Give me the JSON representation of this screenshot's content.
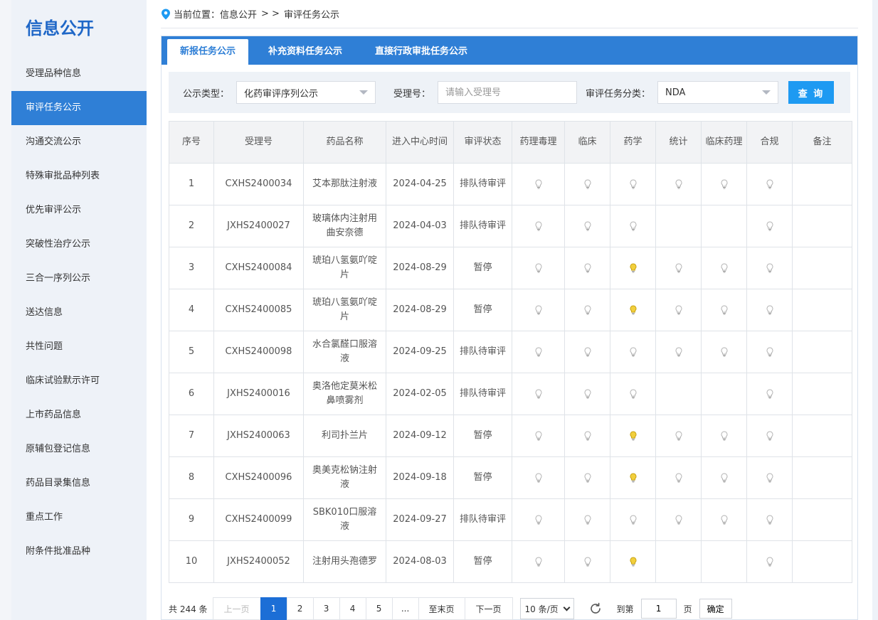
{
  "sidebar": {
    "title": "信息公开",
    "items": [
      {
        "label": "受理品种信息",
        "active": false
      },
      {
        "label": "审评任务公示",
        "active": true
      },
      {
        "label": "沟通交流公示",
        "active": false
      },
      {
        "label": "特殊审批品种列表",
        "active": false
      },
      {
        "label": "优先审评公示",
        "active": false
      },
      {
        "label": "突破性治疗公示",
        "active": false
      },
      {
        "label": "三合一序列公示",
        "active": false
      },
      {
        "label": "送达信息",
        "active": false
      },
      {
        "label": "共性问题",
        "active": false
      },
      {
        "label": "临床试验默示许可",
        "active": false
      },
      {
        "label": "上市药品信息",
        "active": false
      },
      {
        "label": "原辅包登记信息",
        "active": false
      },
      {
        "label": "药品目录集信息",
        "active": false
      },
      {
        "label": "重点工作",
        "active": false
      },
      {
        "label": "附条件批准品种",
        "active": false
      }
    ]
  },
  "breadcrumb": {
    "prefix": "当前位置：",
    "home": "信息公开",
    "separator": "> >",
    "current": "审评任务公示"
  },
  "tabs": [
    {
      "label": "新报任务公示",
      "active": true
    },
    {
      "label": "补充资料任务公示",
      "active": false
    },
    {
      "label": "直接行政审批任务公示",
      "active": false
    }
  ],
  "filters": {
    "type_label": "公示类型：",
    "type_value": "化药审评序列公示",
    "acceptance_label": "受理号：",
    "acceptance_placeholder": "请输入受理号",
    "category_label": "审评任务分类：",
    "category_value": "NDA",
    "query_button": "查 询"
  },
  "colors": {
    "accent": "#2f7fd6",
    "bulb_off": "#c8c8c8",
    "bulb_on": "#f2cf3c"
  },
  "table": {
    "columns": [
      "序号",
      "受理号",
      "药品名称",
      "进入中心时间",
      "审评状态",
      "药理毒理",
      "临床",
      "药学",
      "统计",
      "临床药理",
      "合规",
      "备注"
    ],
    "rows": [
      {
        "no": "1",
        "id": "CXHS2400034",
        "name": "艾本那肽注射液",
        "date": "2024-04-25",
        "status": "排队待审评",
        "bulbs": [
          "off",
          "off",
          "off",
          "off",
          "off",
          "off"
        ],
        "note": ""
      },
      {
        "no": "2",
        "id": "JXHS2400027",
        "name": "玻璃体内注射用曲安奈德",
        "date": "2024-04-03",
        "status": "排队待审评",
        "bulbs": [
          "off",
          "off",
          "off",
          "none",
          "none",
          "off"
        ],
        "note": ""
      },
      {
        "no": "3",
        "id": "CXHS2400084",
        "name": "琥珀八氢氨吖啶片",
        "date": "2024-08-29",
        "status": "暂停",
        "bulbs": [
          "off",
          "off",
          "on",
          "off",
          "off",
          "off"
        ],
        "note": ""
      },
      {
        "no": "4",
        "id": "CXHS2400085",
        "name": "琥珀八氢氨吖啶片",
        "date": "2024-08-29",
        "status": "暂停",
        "bulbs": [
          "off",
          "off",
          "on",
          "off",
          "off",
          "off"
        ],
        "note": ""
      },
      {
        "no": "5",
        "id": "CXHS2400098",
        "name": "水合氯醛口服溶液",
        "date": "2024-09-25",
        "status": "排队待审评",
        "bulbs": [
          "off",
          "off",
          "off",
          "off",
          "off",
          "off"
        ],
        "note": ""
      },
      {
        "no": "6",
        "id": "JXHS2400016",
        "name": "奥洛他定莫米松鼻喷雾剂",
        "date": "2024-02-05",
        "status": "排队待审评",
        "bulbs": [
          "off",
          "off",
          "off",
          "none",
          "none",
          "off"
        ],
        "note": ""
      },
      {
        "no": "7",
        "id": "JXHS2400063",
        "name": "利司扑兰片",
        "date": "2024-09-12",
        "status": "暂停",
        "bulbs": [
          "off",
          "off",
          "on",
          "off",
          "off",
          "off"
        ],
        "note": ""
      },
      {
        "no": "8",
        "id": "CXHS2400096",
        "name": "奥美克松钠注射液",
        "date": "2024-09-18",
        "status": "暂停",
        "bulbs": [
          "off",
          "off",
          "on",
          "off",
          "off",
          "off"
        ],
        "note": ""
      },
      {
        "no": "9",
        "id": "CXHS2400099",
        "name": "SBK010口服溶液",
        "date": "2024-09-27",
        "status": "排队待审评",
        "bulbs": [
          "off",
          "off",
          "off",
          "off",
          "off",
          "off"
        ],
        "note": ""
      },
      {
        "no": "10",
        "id": "JXHS2400052",
        "name": "注射用头孢德罗",
        "date": "2024-08-03",
        "status": "暂停",
        "bulbs": [
          "off",
          "off",
          "on",
          "none",
          "none",
          "off"
        ],
        "note": ""
      }
    ]
  },
  "pagination": {
    "total": "共 244 条",
    "prev": "上一页",
    "pages": [
      "1",
      "2",
      "3",
      "4",
      "5"
    ],
    "current": "1",
    "ellipsis": "...",
    "last": "至末页",
    "next": "下一页",
    "page_size": "10 条/页",
    "goto_label": "到第",
    "goto_value": "1",
    "page_unit": "页",
    "confirm": "确定"
  }
}
